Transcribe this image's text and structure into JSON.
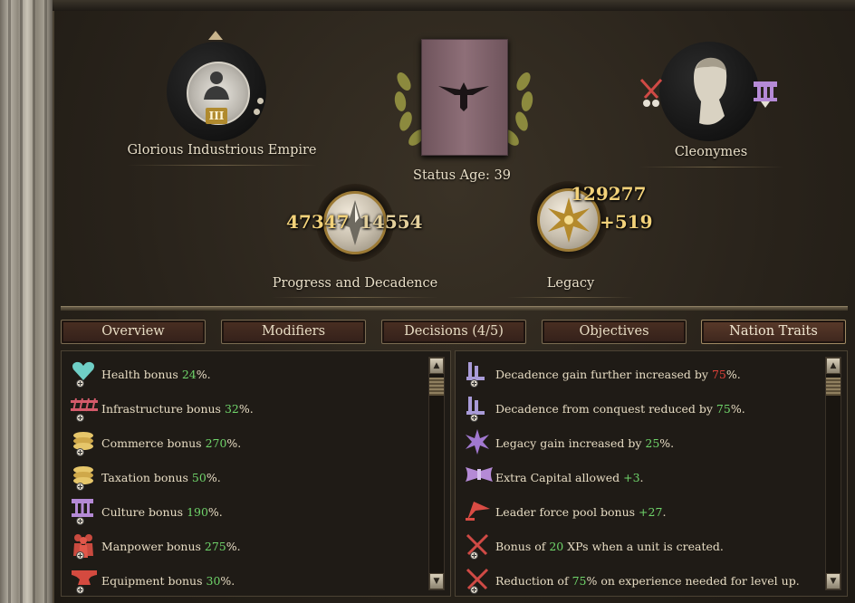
{
  "header": {
    "nation_name": "Glorious Industrious Empire",
    "rank_numeral": "III",
    "status_age_label": "Status Age: 39",
    "leader_name": "Cleonymes"
  },
  "progress": {
    "progress_value": "47347",
    "decadence_value": "14554",
    "label": "Progress and Decadence"
  },
  "legacy": {
    "total": "129277",
    "gain": "+519",
    "label": "Legacy"
  },
  "tabs": [
    {
      "label": "Overview"
    },
    {
      "label": "Modifiers"
    },
    {
      "label": "Decisions (4/5)"
    },
    {
      "label": "Objectives"
    },
    {
      "label": "Nation Traits",
      "active": true
    }
  ],
  "left_traits": [
    {
      "icon": "heart-icon",
      "prefix": "Health bonus ",
      "value": "24",
      "suffix": "%."
    },
    {
      "icon": "infrastructure-icon",
      "prefix": "Infrastructure bonus ",
      "value": "32",
      "suffix": "%."
    },
    {
      "icon": "coins-icon",
      "prefix": "Commerce bonus ",
      "value": "270",
      "suffix": "%."
    },
    {
      "icon": "coins-icon",
      "prefix": "Taxation bonus ",
      "value": "50",
      "suffix": "%."
    },
    {
      "icon": "column-icon",
      "prefix": "Culture bonus ",
      "value": "190",
      "suffix": "%."
    },
    {
      "icon": "soldiers-icon",
      "prefix": "Manpower bonus ",
      "value": "275",
      "suffix": "%."
    },
    {
      "icon": "anvil-icon",
      "prefix": "Equipment bonus ",
      "value": "30",
      "suffix": "%."
    }
  ],
  "right_traits": [
    {
      "icon": "decadence-icon",
      "prefix": "Decadence gain further increased by ",
      "value": "75",
      "suffix": "%.",
      "color": "red"
    },
    {
      "icon": "decadence-icon",
      "prefix": "Decadence from conquest reduced by ",
      "value": "75",
      "suffix": "%.",
      "color": "green"
    },
    {
      "icon": "legacy-star-icon",
      "prefix": "Legacy gain increased by ",
      "value": "25",
      "suffix": "%.",
      "color": "green"
    },
    {
      "icon": "capital-icon",
      "prefix": "Extra Capital allowed ",
      "value": "+3",
      "suffix": ".",
      "color": "green"
    },
    {
      "icon": "flag-icon",
      "prefix": "Leader force pool bonus ",
      "value": "+27",
      "suffix": ".",
      "color": "green"
    },
    {
      "icon": "crossed-swords-icon",
      "prefix": "Bonus of ",
      "value": "20",
      "suffix": " XPs when a unit is created.",
      "color": "green"
    },
    {
      "icon": "crossed-swords-icon",
      "prefix": "Reduction of ",
      "value": "75",
      "suffix": "% on experience needed for level up.",
      "color": "green"
    }
  ],
  "colors": {
    "positive": "#6fd46a",
    "negative": "#e0423a",
    "gold_number": "#f3d27a",
    "banner": "#8a6a73"
  }
}
